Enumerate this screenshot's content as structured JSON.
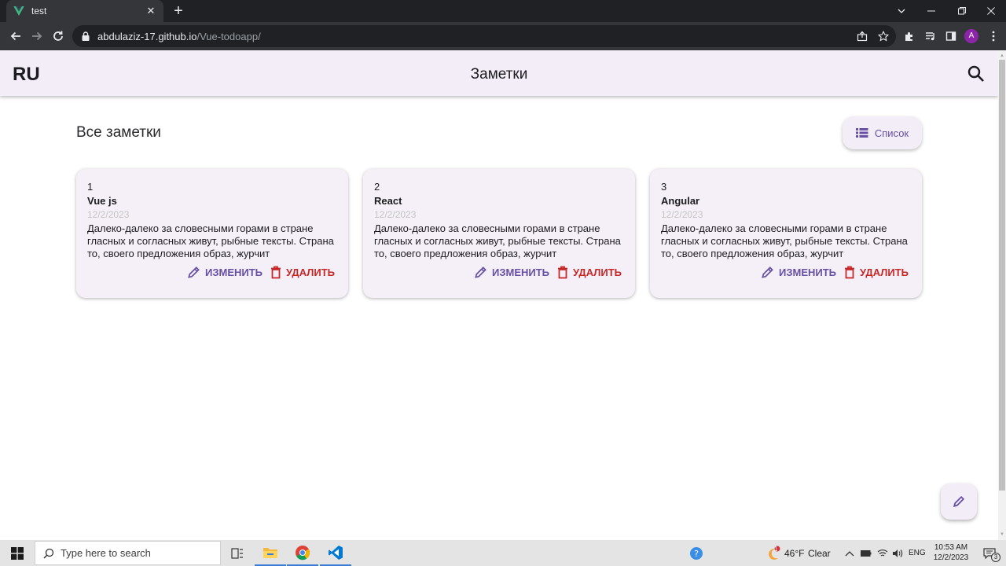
{
  "browser": {
    "tab_title": "test",
    "url_host": "abdulaziz-17.github.io",
    "url_path": "/Vue-todoapp/",
    "avatar_letter": "A",
    "accent": "#8e24aa"
  },
  "app": {
    "lang_label": "RU",
    "title": "Заметки",
    "section_title": "Все заметки",
    "list_button_label": "Список",
    "accent": "#6750a4",
    "danger": "#c62828",
    "notes": [
      {
        "number": "1",
        "title": "Vue js",
        "date": "12/2/2023",
        "text": "Далеко-далеко за словесными горами в стране гласных и согласных живут, рыбные тексты. Страна то, своего предложения образ, журчит",
        "edit_label": "ИЗМЕНИТЬ",
        "delete_label": "УДАЛИТЬ"
      },
      {
        "number": "2",
        "title": "React",
        "date": "12/2/2023",
        "text": "Далеко-далеко за словесными горами в стране гласных и согласных живут, рыбные тексты. Страна то, своего предложения образ, журчит",
        "edit_label": "ИЗМЕНИТЬ",
        "delete_label": "УДАЛИТЬ"
      },
      {
        "number": "3",
        "title": "Angular",
        "date": "12/2/2023",
        "text": "Далеко-далеко за словесными горами в стране гласных и согласных живут, рыбные тексты. Страна то, своего предложения образ, журчит",
        "edit_label": "ИЗМЕНИТЬ",
        "delete_label": "УДАЛИТЬ"
      }
    ]
  },
  "taskbar": {
    "search_placeholder": "Type here to search",
    "weather_temp": "46°F",
    "weather_text": "Clear",
    "weather_badge": "1",
    "language": "ENG",
    "time": "10:53 AM",
    "date": "12/2/2023",
    "notification_count": "3"
  }
}
